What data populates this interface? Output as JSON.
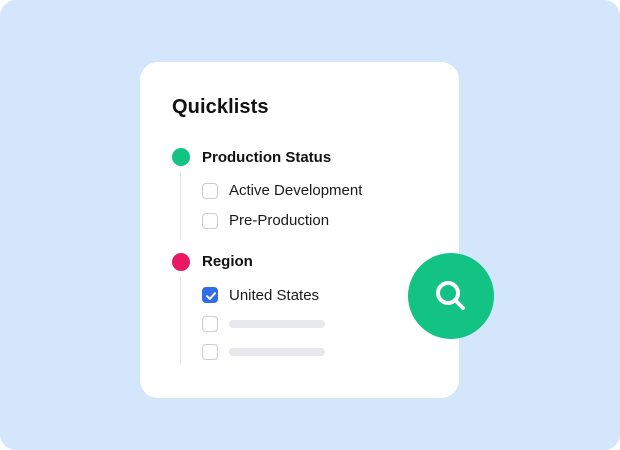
{
  "card": {
    "title": "Quicklists",
    "groups": [
      {
        "label": "Production Status",
        "dot_color": "#13c384",
        "options": [
          {
            "label": "Active Development",
            "checked": false
          },
          {
            "label": "Pre-Production",
            "checked": false
          }
        ]
      },
      {
        "label": "Region",
        "dot_color": "#ea1763",
        "options": [
          {
            "label": "United States",
            "checked": true
          },
          {
            "label": "",
            "checked": false,
            "placeholder": true
          },
          {
            "label": "",
            "checked": false,
            "placeholder": true
          }
        ]
      }
    ]
  },
  "search_button": {
    "icon": "search-icon",
    "color": "#13c384"
  },
  "colors": {
    "background": "#d4e6fb",
    "checked": "#2f6ee8"
  }
}
